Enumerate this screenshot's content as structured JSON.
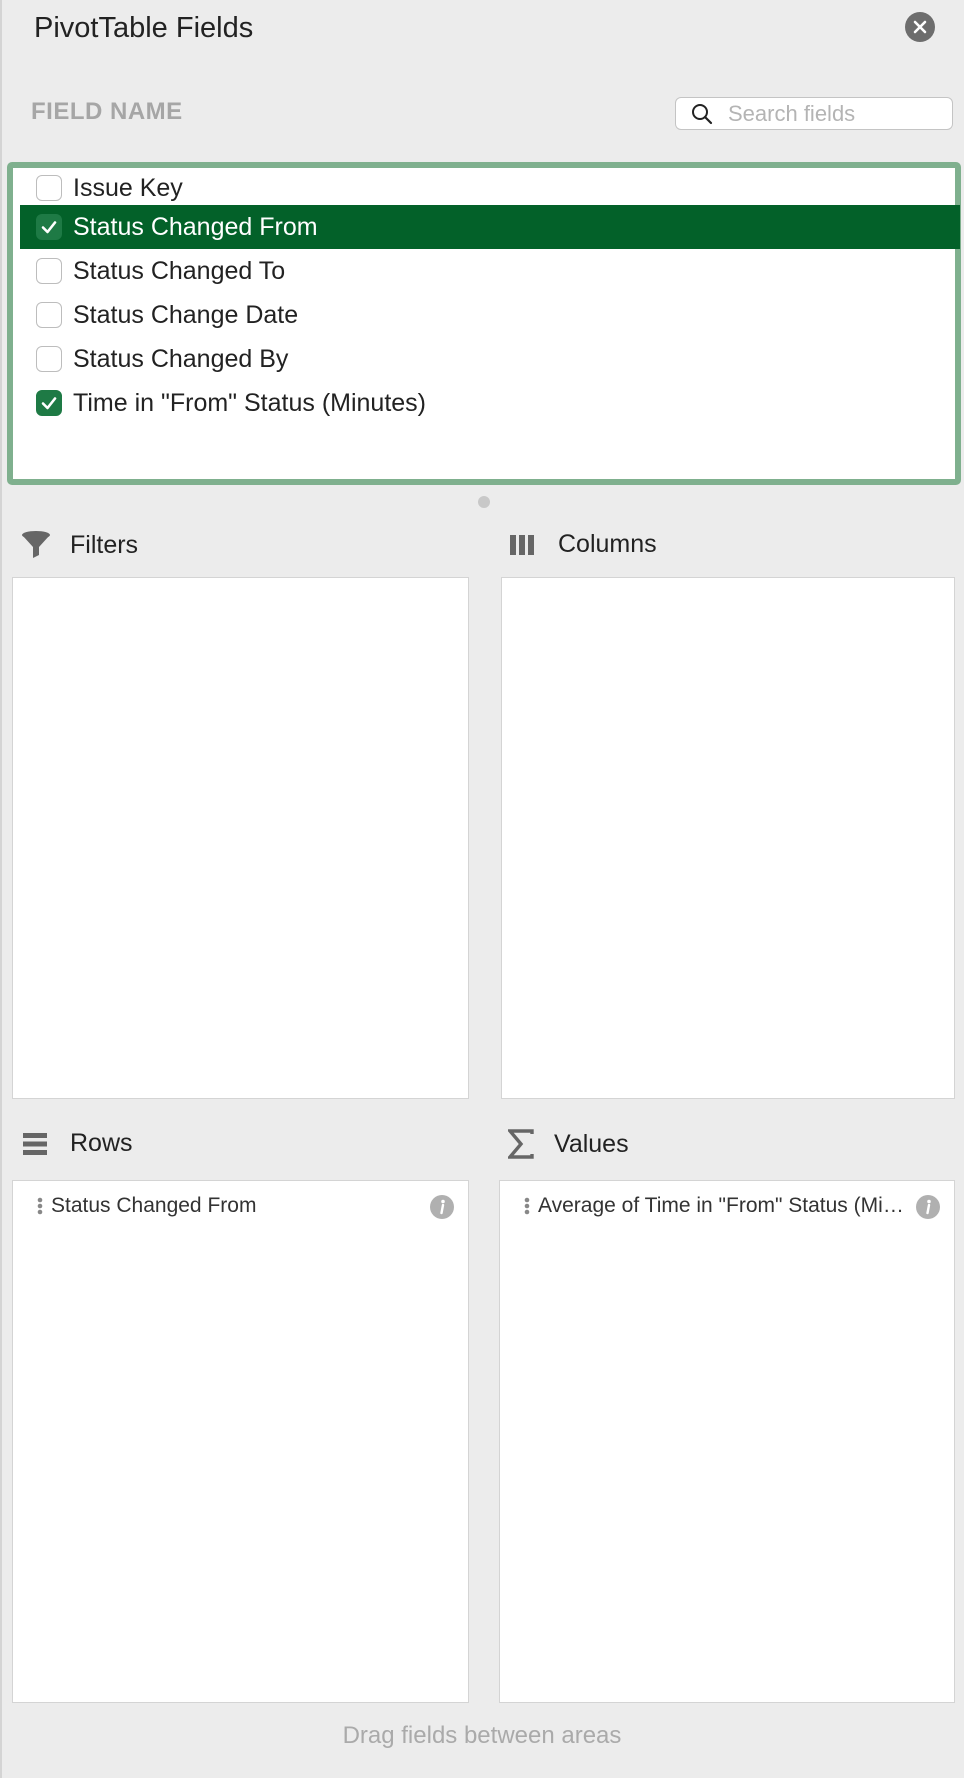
{
  "panel": {
    "title": "PivotTable Fields",
    "close_icon": "close-circle-icon"
  },
  "fields": {
    "header": "FIELD NAME",
    "search_placeholder": "Search fields",
    "search_value": "",
    "items": [
      {
        "label": "Issue Key",
        "checked": false,
        "selected": false
      },
      {
        "label": "Status Changed From",
        "checked": true,
        "selected": true
      },
      {
        "label": "Status Changed To",
        "checked": false,
        "selected": false
      },
      {
        "label": "Status Change Date",
        "checked": false,
        "selected": false
      },
      {
        "label": "Status Changed By",
        "checked": false,
        "selected": false
      },
      {
        "label": "Time in \"From\" Status (Minutes)",
        "checked": true,
        "selected": false
      }
    ]
  },
  "areas": {
    "filters": {
      "label": "Filters",
      "icon": "filter-funnel-icon",
      "items": []
    },
    "columns": {
      "label": "Columns",
      "icon": "columns-icon",
      "items": []
    },
    "rows": {
      "label": "Rows",
      "icon": "rows-icon",
      "items": [
        {
          "label": "Status Changed From"
        }
      ]
    },
    "values": {
      "label": "Values",
      "icon": "sigma-icon",
      "items": [
        {
          "label": "Average of Time in \"From\" Status (Minutes)"
        }
      ]
    }
  },
  "footer": {
    "hint": "Drag fields between areas"
  },
  "colors": {
    "accent_green": "#036129",
    "checkbox_green": "#1e7a45",
    "list_border": "#7fb08e",
    "panel_bg": "#ececec"
  }
}
